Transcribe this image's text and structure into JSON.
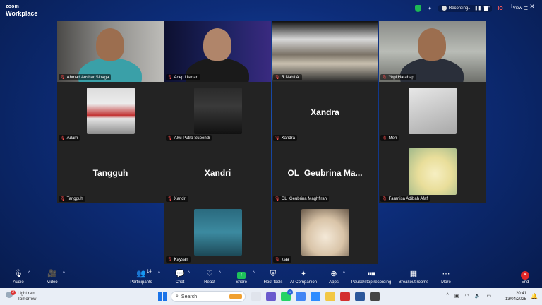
{
  "app": {
    "logo_line1": "zoom",
    "logo_line2": "Workplace",
    "recording_label": "Recording...",
    "view_label": "View"
  },
  "participants": [
    {
      "name": "Ahmad Anshar Sinaga",
      "type": "video",
      "scene": "s1"
    },
    {
      "name": "Acep Usman",
      "type": "video",
      "scene": "s2"
    },
    {
      "name": "R.Nabil A.",
      "type": "video",
      "scene": "s3"
    },
    {
      "name": "Yopi Harahap",
      "type": "video",
      "scene": "s4",
      "active": true
    },
    {
      "name": "Adam",
      "type": "avatar",
      "avatar": "av-train"
    },
    {
      "name": "Alwi Putra Supendi",
      "type": "avatar",
      "avatar": "av-man"
    },
    {
      "name": "Xandra",
      "type": "text",
      "display": "Xandra"
    },
    {
      "name": "Meh",
      "type": "avatar",
      "avatar": "av-sketch"
    },
    {
      "name": "Tangguh",
      "type": "text",
      "display": "Tangguh"
    },
    {
      "name": "Xandri",
      "type": "text",
      "display": "Xandri"
    },
    {
      "name": "OL_Geubrina Maghfirah",
      "type": "text",
      "display": "OL_Geubrina  Ma..."
    },
    {
      "name": "Faranisa Adibah Afaf",
      "type": "avatar",
      "avatar": "av-chick"
    },
    {
      "name": "Kaysan",
      "type": "avatar",
      "avatar": "av-fish"
    },
    {
      "name": "kiaa",
      "type": "avatar",
      "avatar": "av-chick2"
    }
  ],
  "toolbar": {
    "audio": "Audio",
    "video": "Video",
    "participants": "Participants",
    "participants_count": "14",
    "chat": "Chat",
    "react": "React",
    "share": "Share",
    "host_tools": "Host tools",
    "ai_companion": "AI Companion",
    "apps": "Apps",
    "pause_stop": "Pause/stop recording",
    "breakout": "Breakout rooms",
    "more": "More",
    "end": "End"
  },
  "taskbar": {
    "weather_line1": "Light rain",
    "weather_line2": "Tomorrow",
    "weather_badge": "2",
    "search_placeholder": "Search",
    "whatsapp_badge": "10",
    "time": "20:41",
    "date": "13/04/2025"
  },
  "colors": {
    "active_speaker": "#3ad45a",
    "muted": "#ff4d4d",
    "share": "#1ec15a",
    "end": "#e02828"
  }
}
